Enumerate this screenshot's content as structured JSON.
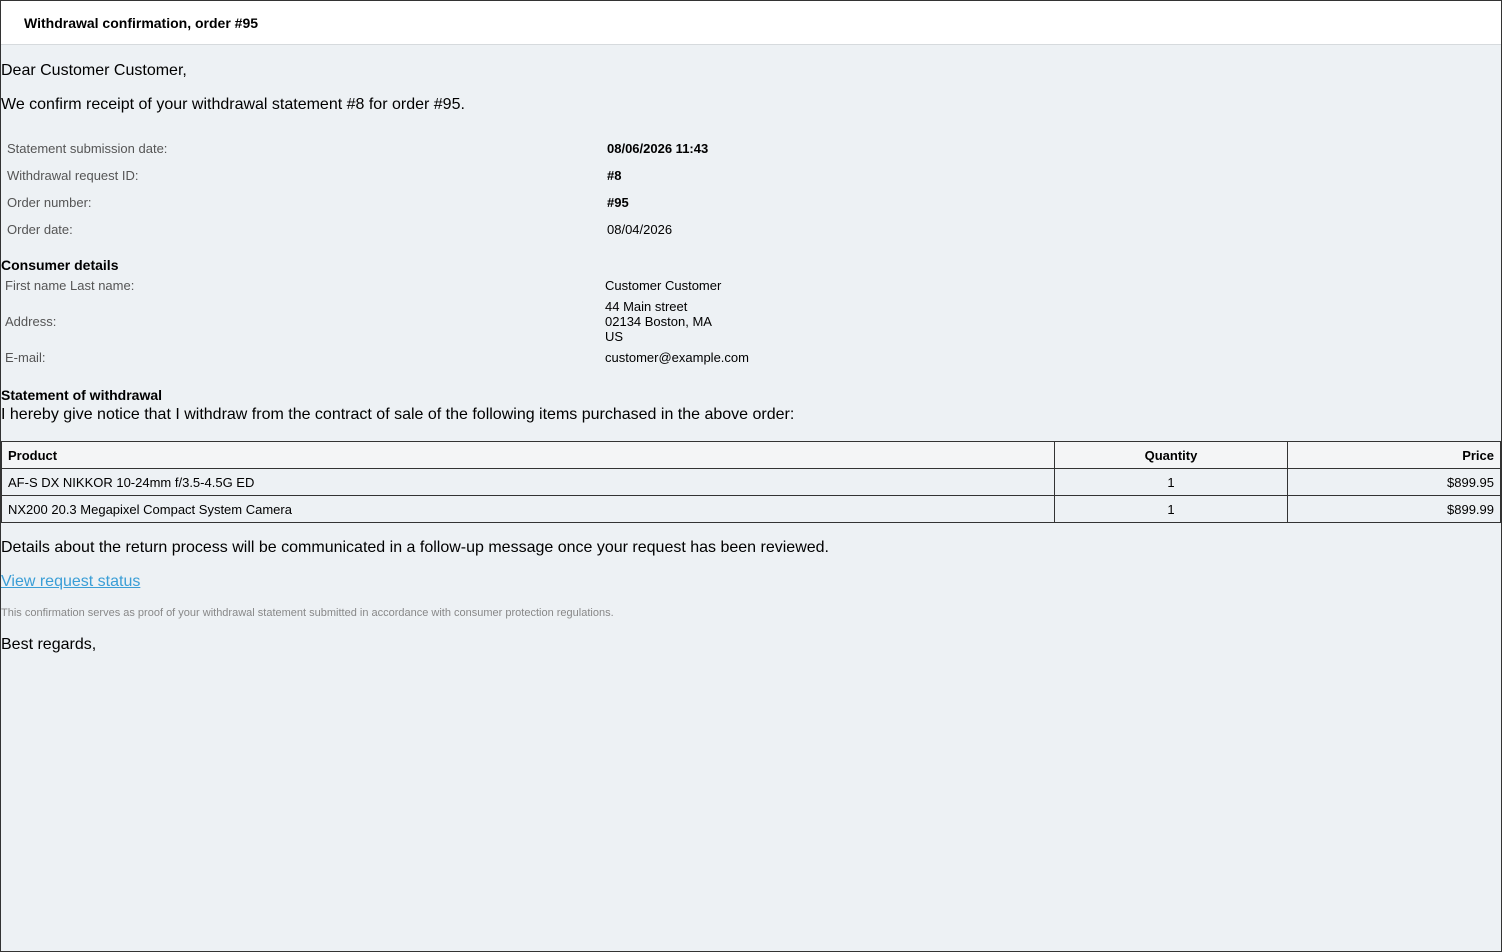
{
  "header": {
    "title": "Withdrawal confirmation, order #95"
  },
  "greeting": "Dear Customer Customer,",
  "intro": "We confirm receipt of your withdrawal statement #8 for order #95.",
  "meta": [
    {
      "label": "Statement submission date:",
      "value": "08/06/2026 11:43"
    },
    {
      "label": "Withdrawal request ID:",
      "value": "#8"
    },
    {
      "label": "Order number:",
      "value": "#95"
    },
    {
      "label": "Order date:",
      "value": "08/04/2026"
    }
  ],
  "consumer": {
    "title": "Consumer details",
    "name_label": "First name Last name:",
    "name_value": "Customer Customer",
    "address_label": "Address:",
    "address_line1": "44 Main street",
    "address_line2": "02134 Boston, MA",
    "address_line3": "US",
    "email_label": "E-mail:",
    "email_value": "customer@example.com"
  },
  "statement": {
    "title": "Statement of withdrawal",
    "notice": "I hereby give notice that I withdraw from the contract of sale of the following items purchased in the above order:"
  },
  "items_table": {
    "headers": {
      "product": "Product",
      "quantity": "Quantity",
      "price": "Price"
    },
    "rows": [
      {
        "product": "AF-S DX NIKKOR 10-24mm f/3.5-4.5G ED",
        "quantity": "1",
        "price": "$899.95"
      },
      {
        "product": "NX200 20.3 Megapixel Compact System Camera",
        "quantity": "1",
        "price": "$899.99"
      }
    ]
  },
  "details": "Details about the return process will be communicated in a follow-up message once your request has been reviewed.",
  "link_label": "View request status",
  "fine_print": "This confirmation serves as proof of your withdrawal statement submitted in accordance with consumer protection regulations.",
  "regards": "Best regards,",
  "colors": {
    "background": "#edf1f4",
    "link": "#3a9ed6",
    "header_bg": "#ffffff"
  }
}
